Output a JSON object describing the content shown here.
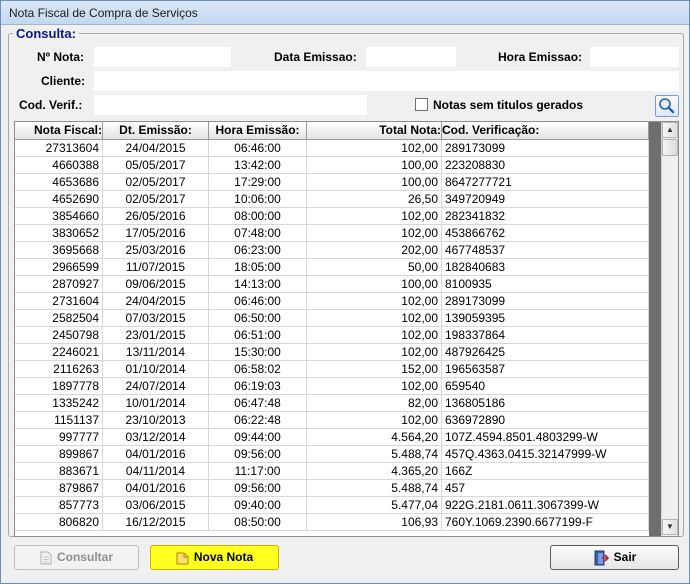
{
  "window": {
    "title": "Nota Fiscal de Compra de Serviços"
  },
  "consulta": {
    "legend": "Consulta:",
    "nota_label": "Nº Nota:",
    "nota_value": "",
    "data_emissao_label": "Data Emissao:",
    "data_emissao_value": "",
    "hora_emissao_label": "Hora Emissao:",
    "hora_emissao_value": "",
    "cliente_label": "Cliente:",
    "cliente_value": "",
    "cod_verif_label": "Cod. Verif.:",
    "cod_verif_value": "",
    "checkbox_label": "Notas sem titulos gerados",
    "checkbox_checked": false,
    "search_icon": "magnifier-icon"
  },
  "grid": {
    "columns": [
      "Nota Fiscal:",
      "Dt. Emissão:",
      "Hora Emissão:",
      "Total Nota:",
      "Cod. Verificação:"
    ],
    "rows": [
      [
        "27313604",
        "24/04/2015",
        "06:46:00",
        "102,00",
        "289173099"
      ],
      [
        "4660388",
        "05/05/2017",
        "13:42:00",
        "100,00",
        "223208830"
      ],
      [
        "4653686",
        "02/05/2017",
        "17:29:00",
        "100,00",
        "8647277721"
      ],
      [
        "4652690",
        "02/05/2017",
        "10:06:00",
        "26,50",
        "349720949"
      ],
      [
        "3854660",
        "26/05/2016",
        "08:00:00",
        "102,00",
        "282341832"
      ],
      [
        "3830652",
        "17/05/2016",
        "07:48:00",
        "102,00",
        "453866762"
      ],
      [
        "3695668",
        "25/03/2016",
        "06:23:00",
        "202,00",
        "467748537"
      ],
      [
        "2966599",
        "11/07/2015",
        "18:05:00",
        "50,00",
        "182840683"
      ],
      [
        "2870927",
        "09/06/2015",
        "14:13:00",
        "100,00",
        "8100935"
      ],
      [
        "2731604",
        "24/04/2015",
        "06:46:00",
        "102,00",
        "289173099"
      ],
      [
        "2582504",
        "07/03/2015",
        "06:50:00",
        "102,00",
        "139059395"
      ],
      [
        "2450798",
        "23/01/2015",
        "06:51:00",
        "102,00",
        "198337864"
      ],
      [
        "2246021",
        "13/11/2014",
        "15:30:00",
        "102,00",
        "487926425"
      ],
      [
        "2116263",
        "01/10/2014",
        "06:58:02",
        "152,00",
        "196563587"
      ],
      [
        "1897778",
        "24/07/2014",
        "06:19:03",
        "102,00",
        "659540"
      ],
      [
        "1335242",
        "10/01/2014",
        "06:47:48",
        "82,00",
        "136805186"
      ],
      [
        "1151137",
        "23/10/2013",
        "06:22:48",
        "102,00",
        "636972890"
      ],
      [
        "997777",
        "03/12/2014",
        "09:44:00",
        "4.564,20",
        "107Z.4594.8501.4803299-W"
      ],
      [
        "899867",
        "04/01/2016",
        "09:56:00",
        "5.488,74",
        "457Q.4363.0415.32147999-W"
      ],
      [
        "883671",
        "04/11/2014",
        "11:17:00",
        "4.365,20",
        "166Z"
      ],
      [
        "879867",
        "04/01/2016",
        "09:56:00",
        "5.488,74",
        "457"
      ],
      [
        "857773",
        "03/06/2015",
        "09:40:00",
        "5.477,04",
        "922G.2181.0611.3067399-W"
      ],
      [
        "806820",
        "16/12/2015",
        "08:50:00",
        "106,93",
        "760Y.1069.2390.6677199-F"
      ]
    ]
  },
  "buttons": {
    "consultar": "Consultar",
    "nova_nota": "Nova Nota",
    "sair": "Sair"
  }
}
